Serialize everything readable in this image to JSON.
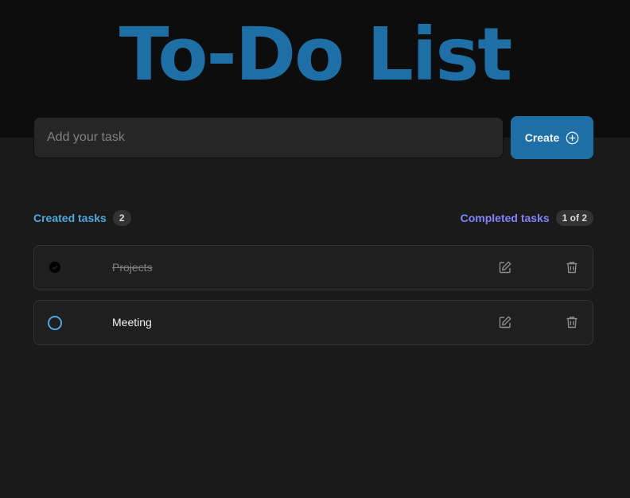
{
  "header": {
    "title": "To-Do List"
  },
  "form": {
    "placeholder": "Add your task",
    "value": "",
    "create_label": "Create"
  },
  "info": {
    "created_label": "Created tasks",
    "created_count": "2",
    "completed_label": "Completed tasks",
    "completed_count": "1 of 2"
  },
  "tasks": [
    {
      "text": "Projects",
      "completed": true
    },
    {
      "text": "Meeting",
      "completed": false
    }
  ],
  "icons": {
    "create": "plus-circle-icon",
    "check": "check-icon",
    "edit": "pencil-square-icon",
    "delete": "trash-icon"
  },
  "colors": {
    "accent": "#1e6fa5",
    "created_label": "#4ea8de",
    "completed_label": "#8284fa",
    "background": "#1a1a1a",
    "header_background": "#0d0d0d"
  }
}
